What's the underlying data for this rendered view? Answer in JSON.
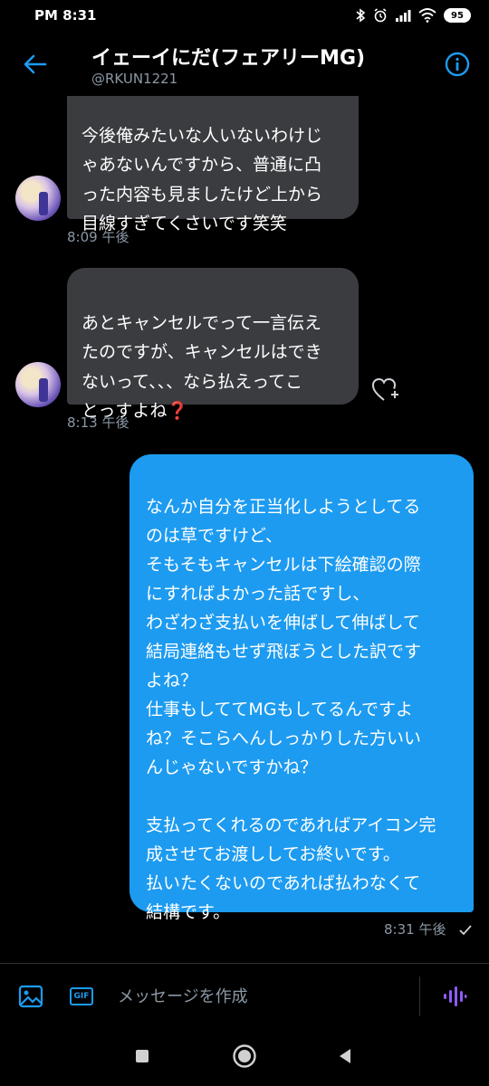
{
  "status_bar": {
    "time": "PM 8:31",
    "battery": "95",
    "icons": [
      "bluetooth-icon",
      "alarm-icon",
      "signal-icon",
      "wifi-icon",
      "battery-icon"
    ]
  },
  "header": {
    "title": "イェーイにだ(フェアリーMG)",
    "handle": "@RKUN1221",
    "back_icon": "back-arrow-icon",
    "info_icon": "info-icon"
  },
  "messages": [
    {
      "direction": "in",
      "text": "今後俺みたいな人いないわけじ\nゃあないんですから、普通に凸\nった内容も見ましたけど上から\n目線すぎてくさいです笑笑",
      "time": "8:09 午後"
    },
    {
      "direction": "in",
      "text": "あとキャンセルでって一言伝え\nたのですが、キャンセルはでき\nないって、、、なら払えってこ\nとっすよね❓",
      "time": "8:13 午後"
    },
    {
      "direction": "out",
      "text": "なんか自分を正当化しようとしてる\nのは草ですけど、\nそもそもキャンセルは下絵確認の際\nにすればよかった話ですし、\nわざわざ支払いを伸ばして伸ばして\n結局連絡もせず飛ぼうとした訳です\nよね？\n仕事もしててMGもしてるんですよ\nね？そこらへんしっかりした方いい\nんじゃないですかね？\n\n支払ってくれるのであればアイコン完\n成させてお渡ししてお終いです。\n払いたくないのであれば払わなくて\n結構です。",
      "time": "8:31 午後"
    }
  ],
  "composer": {
    "placeholder": "メッセージを作成",
    "gif_label": "GIF",
    "icons": [
      "image-icon",
      "gif-icon",
      "voice-icon"
    ]
  },
  "navbar": {
    "icons": [
      "recents-icon",
      "home-icon",
      "back-icon"
    ]
  },
  "colors": {
    "background": "#000000",
    "accent": "#1d9bf0",
    "incoming_bubble": "#3a3c40",
    "secondary_text": "#8b98a5",
    "voice_accent": "#8e5cf6"
  }
}
